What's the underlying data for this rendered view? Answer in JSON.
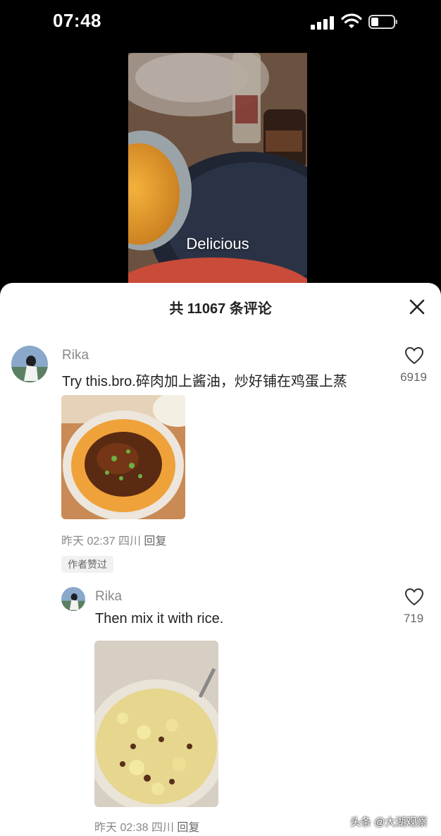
{
  "status_bar": {
    "time": "07:48"
  },
  "video": {
    "caption": "Delicious"
  },
  "comments_panel": {
    "title": "共 11067 条评论",
    "comments": [
      {
        "username": "Rika",
        "text": "Try this.bro.碎肉加上酱油，炒好铺在鸡蛋上蒸",
        "likes": "6919",
        "date": "昨天 02:37",
        "location": "四川",
        "reply_label": "回复",
        "badge": "作者赞过"
      }
    ],
    "reply": {
      "username": "Rika",
      "text": "Then mix it with rice.",
      "likes": "719",
      "date": "昨天 02:38",
      "location": "四川",
      "reply_label": "回复"
    }
  },
  "watermark": "头条 @大湖观察",
  "colors": {
    "sheet_bg": "#ffffff",
    "username": "#8a8a8a",
    "text": "#222222",
    "meta": "#888888"
  }
}
